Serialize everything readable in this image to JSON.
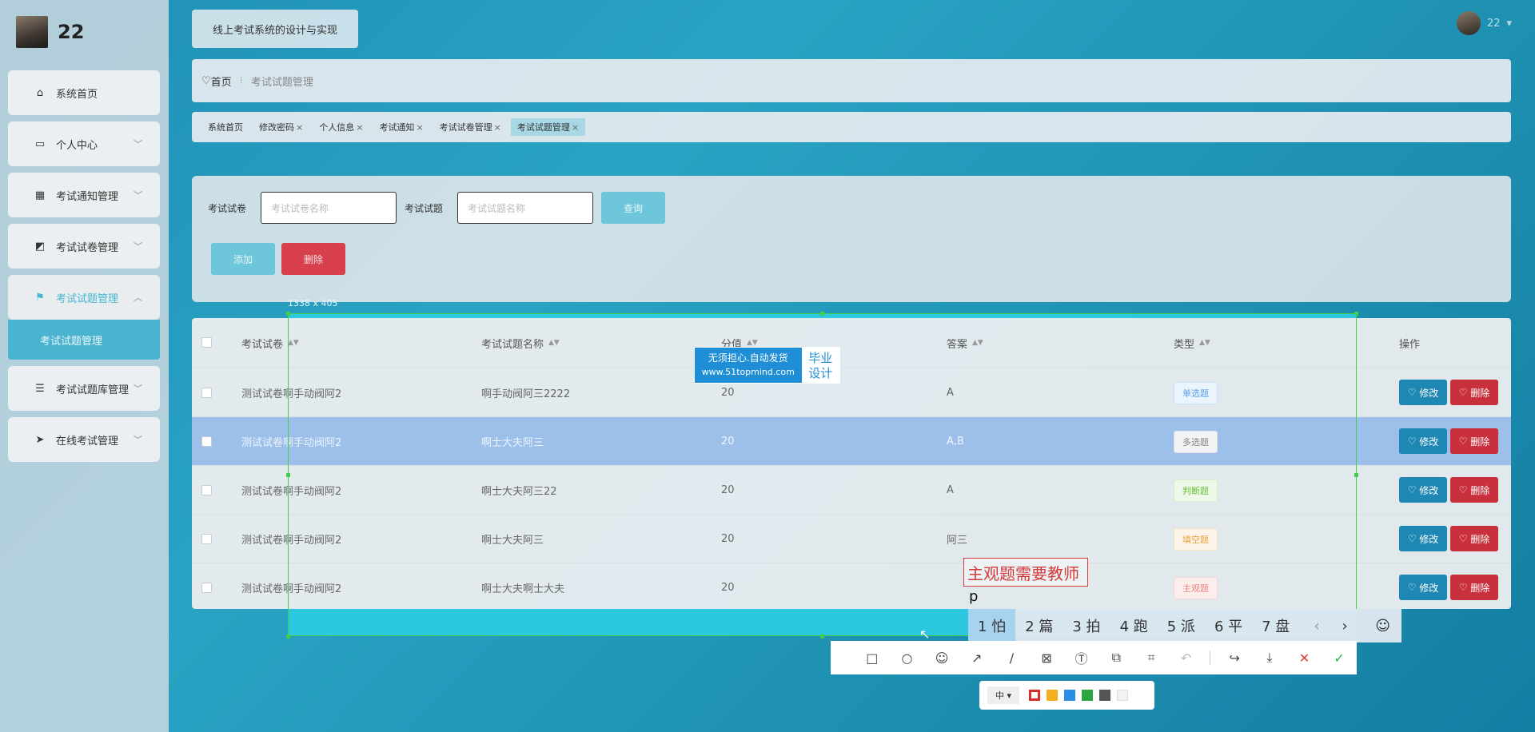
{
  "user": {
    "name": "22"
  },
  "menu": [
    {
      "label": "系统首页",
      "icon": "home-icon",
      "chevron": false
    },
    {
      "label": "个人中心",
      "icon": "calendar-icon",
      "chevron": true
    },
    {
      "label": "考试通知管理",
      "icon": "grid-icon",
      "chevron": true
    },
    {
      "label": "考试试卷管理",
      "icon": "chart-icon",
      "chevron": true
    },
    {
      "label": "考试试题管理",
      "icon": "flag-icon",
      "chevron": true,
      "active": true
    },
    {
      "label": "考试试题库管理",
      "icon": "list-icon",
      "chevron": true
    },
    {
      "label": "在线考试管理",
      "icon": "send-icon",
      "chevron": true
    }
  ],
  "submenu": {
    "label": "考试试题管理"
  },
  "header": {
    "system_title": "线上考试系统的设计与实现",
    "username": "22"
  },
  "breadcrumb": {
    "home": "首页",
    "current": "考试试题管理"
  },
  "tabs": [
    {
      "label": "系统首页",
      "closable": false
    },
    {
      "label": "修改密码",
      "closable": true
    },
    {
      "label": "个人信息",
      "closable": true
    },
    {
      "label": "考试通知",
      "closable": true
    },
    {
      "label": "考试试卷管理",
      "closable": true
    },
    {
      "label": "考试试题管理",
      "closable": true,
      "active": true
    }
  ],
  "search": {
    "paper_label": "考试试卷",
    "paper_placeholder": "考试试卷名称",
    "question_label": "考试试题",
    "question_placeholder": "考试试题名称",
    "query_button": "查询",
    "add_button": "添加",
    "delete_button": "删除"
  },
  "table": {
    "headers": [
      "考试试卷",
      "考试试题名称",
      "分值",
      "答案",
      "类型",
      "操作"
    ],
    "edit_label": "修改",
    "delete_label": "删除",
    "rows": [
      {
        "paper": "测试试卷啊手动阀阿2",
        "name": "啊手动阀阿三2222",
        "score": "20",
        "answer": "A",
        "type": "单选题",
        "tag": "t-single"
      },
      {
        "paper": "测试试卷啊手动阀阿2",
        "name": "啊士大夫阿三",
        "score": "20",
        "answer": "A,B",
        "type": "多选题",
        "tag": "t-multi",
        "selected": true
      },
      {
        "paper": "测试试卷啊手动阀阿2",
        "name": "啊士大夫阿三22",
        "score": "20",
        "answer": "A",
        "type": "判断题",
        "tag": "t-judge"
      },
      {
        "paper": "测试试卷啊手动阀阿2",
        "name": "啊士大夫阿三",
        "score": "20",
        "answer": "阿三",
        "type": "填空题",
        "tag": "t-fill"
      },
      {
        "paper": "测试试卷啊手动阀阿2",
        "name": "啊士大夫啊士大夫",
        "score": "20",
        "answer": "",
        "type": "主观题",
        "tag": "t-subj"
      }
    ]
  },
  "screenshot_overlay": {
    "size_readout": "1338 x 405",
    "watermark_left_line1": "无须担心.自动发货",
    "watermark_left_line2": "www.51topmind.com",
    "watermark_right_line1": "毕业",
    "watermark_right_line2": "设计",
    "annotation_text": "主观题需要教师",
    "ime_input": "p",
    "ime_candidates": [
      "1 怕",
      "2 篇",
      "3 拍",
      "4 跑",
      "5 派",
      "6 平",
      "7 盘"
    ],
    "pen_size": "中",
    "colors": [
      "#e02a2a",
      "#f2b01e",
      "#2a8ee6",
      "#2aa640",
      "#555555",
      "#f2f2f2"
    ]
  }
}
